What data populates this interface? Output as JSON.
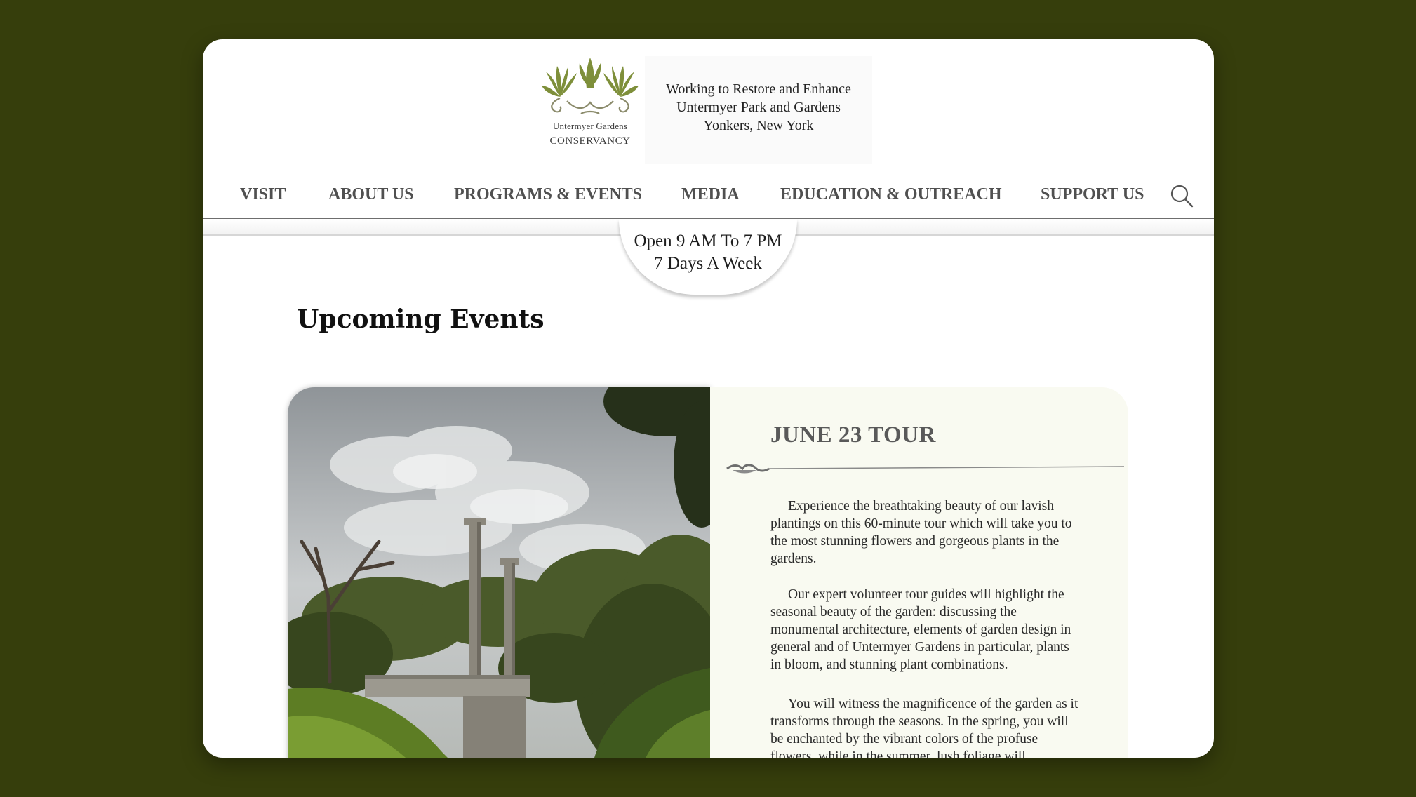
{
  "header": {
    "logo_line1": "Untermyer Gardens",
    "logo_line2": "Conservancy",
    "tagline": [
      "Working to Restore and Enhance",
      "Untermyer Park and Gardens",
      "Yonkers, New York"
    ]
  },
  "nav": {
    "items": [
      "VISIT",
      "ABOUT US",
      "PROGRAMS & EVENTS",
      "MEDIA",
      "EDUCATION & OUTREACH",
      "SUPPORT US"
    ],
    "search_icon": "search-icon"
  },
  "hours": {
    "line1": "Open 9 AM To 7 PM",
    "line2": "7 Days A Week"
  },
  "section": {
    "title": "Upcoming Events"
  },
  "event": {
    "title": "JUNE 23 TOUR",
    "paragraphs": [
      "Experience the breathtaking beauty of our lavish plantings on this 60-minute tour which will take you to the most stunning flowers and gorgeous plants in the gardens.",
      "Our expert volunteer tour guides will highlight the seasonal beauty of the garden: discussing the monumental architecture, elements of garden design in general and of Untermyer Gardens in particular, plants in bloom, and stunning plant combinations.",
      "You will witness the magnificence of the garden as it transforms through the seasons. In the spring, you will be enchanted by the vibrant colors of the profuse flowers, while in the summer, lush foliage will"
    ]
  },
  "colors": {
    "background": "#363e0c",
    "logo_green": "#7e8f3a",
    "nav_text": "#505050",
    "info_panel": "#f9faf1"
  }
}
